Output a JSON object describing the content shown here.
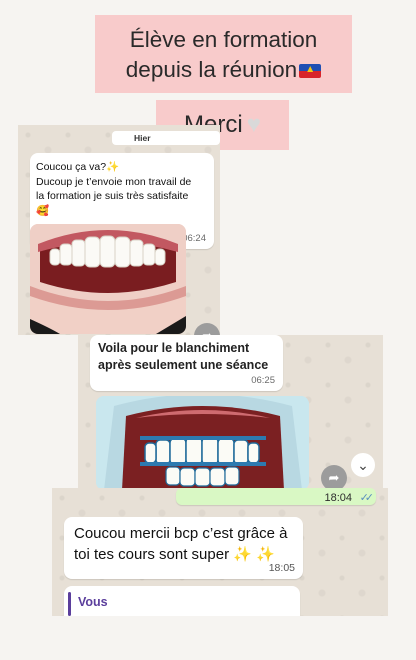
{
  "story": {
    "title_line1": "Élève en formation",
    "title_line2": "depuis la réunion",
    "merci": "Merci"
  },
  "chat1": {
    "date_chip": "Hier",
    "message_lines": [
      "Coucou ça va?",
      "Ducoup je t’envoie mon travail de",
      "la formation je suis très satisfaite"
    ],
    "message_time": "06:24"
  },
  "chat2": {
    "message_lines": [
      "Voila pour le blanchiment",
      "après seulement une séance"
    ],
    "message_time": "06:25"
  },
  "chat3": {
    "outgoing_time": "18:04",
    "message_lines": [
      "Coucou mercii bcp c’est grâce à",
      "toi tes cours sont super"
    ],
    "message_time": "18:05",
    "quote_name": "Vous"
  },
  "icons": {
    "flag": "reunion-flag-icon",
    "heart": "white-heart-icon",
    "sparkles": "sparkles-icon",
    "emoji": "smiling-face-with-hearts-icon",
    "share": "share-forward-icon",
    "scroll_down": "chevron-down-icon",
    "read": "double-check-icon"
  }
}
